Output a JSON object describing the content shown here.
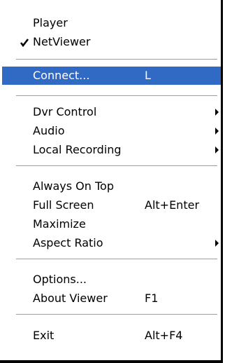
{
  "menu": {
    "player": {
      "label": "Player"
    },
    "netviewer": {
      "label": "NetViewer",
      "checked": true
    },
    "connect": {
      "label": "Connect...",
      "shortcut": "L"
    },
    "dvr_control": {
      "label": "Dvr Control",
      "has_submenu": true
    },
    "audio": {
      "label": "Audio",
      "has_submenu": true
    },
    "local_recording": {
      "label": "Local Recording",
      "has_submenu": true
    },
    "always_on_top": {
      "label": "Always On Top"
    },
    "full_screen": {
      "label": "Full Screen",
      "shortcut": "Alt+Enter"
    },
    "maximize": {
      "label": "Maximize"
    },
    "aspect_ratio": {
      "label": "Aspect Ratio",
      "has_submenu": true
    },
    "options": {
      "label": "Options..."
    },
    "about_viewer": {
      "label": "About Viewer",
      "shortcut": "F1"
    },
    "exit": {
      "label": "Exit",
      "shortcut": "Alt+F4"
    }
  },
  "colors": {
    "highlight": "#316ac5",
    "highlight_text": "#ffffff",
    "text": "#000000",
    "separator": "#9d9d9d",
    "background": "#ffffff"
  },
  "icons": {
    "check": "check-icon",
    "submenu_arrow": "submenu-arrow-icon"
  }
}
